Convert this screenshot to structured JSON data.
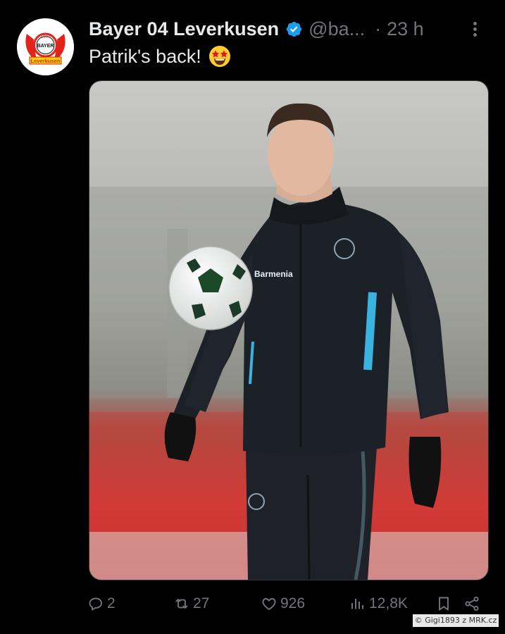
{
  "tweet": {
    "author_name": "Bayer 04 Leverkusen",
    "handle": "@ba...",
    "separator": "·",
    "time": "23 h",
    "text": "Patrik's back!",
    "emoji": "star-struck-emoji",
    "verified": true
  },
  "avatar": {
    "icon": "bayer-04-leverkusen-logo"
  },
  "media": {
    "type": "photo",
    "subject": "player juggling football at training"
  },
  "actions": {
    "replies": "2",
    "retweets": "27",
    "likes": "926",
    "views": "12,8K"
  },
  "watermark": {
    "text": "© Gigi1893 z MRK.cz"
  },
  "colors": {
    "background": "#000000",
    "text_primary": "#e7e9ea",
    "text_secondary": "#71767b",
    "verified": "#1d9bf0"
  }
}
